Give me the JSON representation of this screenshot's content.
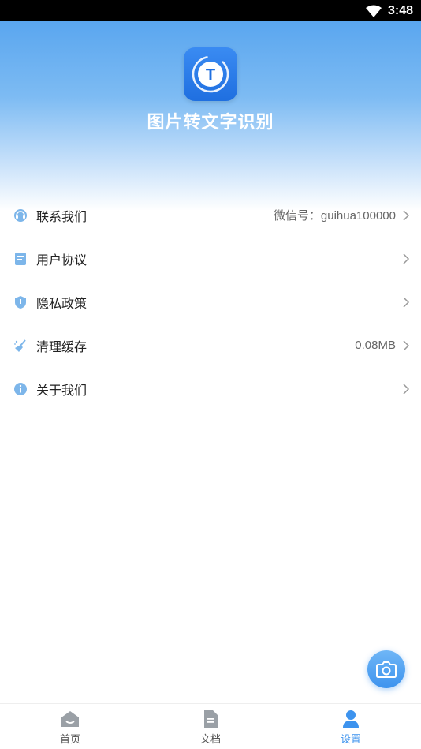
{
  "status_bar": {
    "time": "3:48"
  },
  "app": {
    "title": "图片转文字识别",
    "logo_letter": "T"
  },
  "menu": [
    {
      "name": "contact-us",
      "label": "联系我们",
      "value": "微信号：guihua100000"
    },
    {
      "name": "user-agreement",
      "label": "用户协议",
      "value": ""
    },
    {
      "name": "privacy-policy",
      "label": "隐私政策",
      "value": ""
    },
    {
      "name": "clear-cache",
      "label": "清理缓存",
      "value": "0.08MB"
    },
    {
      "name": "about-us",
      "label": "关于我们",
      "value": ""
    }
  ],
  "tabs": [
    {
      "label": "首页",
      "icon": "home-icon",
      "active": false
    },
    {
      "label": "文档",
      "icon": "document-icon",
      "active": false
    },
    {
      "label": "设置",
      "icon": "user-icon",
      "active": true
    }
  ],
  "colors": {
    "accent": "#3d93ee",
    "header_top": "#5aa6ef",
    "icon": "#7db6ea"
  }
}
